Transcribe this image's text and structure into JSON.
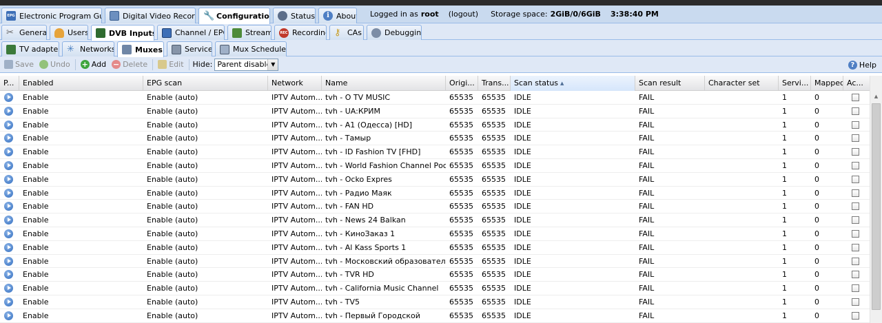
{
  "main_tabs": [
    {
      "label": "Electronic Program Guide",
      "icon": "epg-icon",
      "icon_text": "EPG",
      "active": false
    },
    {
      "label": "Digital Video Recorder",
      "icon": "dvr-icon",
      "active": false
    },
    {
      "label": "Configuration",
      "icon": "wrench-icon",
      "active": true
    },
    {
      "label": "Status",
      "icon": "eye-icon",
      "active": false
    },
    {
      "label": "About",
      "icon": "info-icon",
      "icon_text": "i",
      "active": false
    }
  ],
  "session": {
    "logged_in_prefix": "Logged in as",
    "user": "root",
    "logout": "(logout)",
    "storage_label": "Storage space:",
    "storage_value": "2GiB/0/6GiB",
    "time": "3:38:40 PM"
  },
  "config_tabs": [
    {
      "label": "General",
      "icon": "tools-icon",
      "active": false
    },
    {
      "label": "Users",
      "icon": "users-icon",
      "active": false
    },
    {
      "label": "DVB Inputs",
      "icon": "dvb-icon",
      "active": true
    },
    {
      "label": "Channel / EPG",
      "icon": "tv-icon",
      "active": false
    },
    {
      "label": "Stream",
      "icon": "stream-icon",
      "active": false
    },
    {
      "label": "Recording",
      "icon": "rec-icon",
      "icon_text": "REC",
      "active": false
    },
    {
      "label": "CAs",
      "icon": "key-icon",
      "active": false
    },
    {
      "label": "Debugging",
      "icon": "debug-icon",
      "active": false
    }
  ],
  "dvb_tabs": [
    {
      "label": "TV adapters",
      "icon": "adapter-icon",
      "active": false
    },
    {
      "label": "Networks",
      "icon": "network-icon",
      "active": false
    },
    {
      "label": "Muxes",
      "icon": "mux-icon",
      "active": true
    },
    {
      "label": "Services",
      "icon": "services-icon",
      "active": false
    },
    {
      "label": "Mux Schedulers",
      "icon": "scheduler-icon",
      "active": false
    }
  ],
  "toolbar": {
    "save": "Save",
    "undo": "Undo",
    "add": "Add",
    "add_symbol": "+",
    "delete": "Delete",
    "delete_symbol": "−",
    "edit": "Edit",
    "hide_label": "Hide:",
    "hide_value": "Parent disabled",
    "help": "Help",
    "help_symbol": "?"
  },
  "columns": [
    {
      "label": "P..."
    },
    {
      "label": "Enabled"
    },
    {
      "label": "EPG scan"
    },
    {
      "label": "Network"
    },
    {
      "label": "Name"
    },
    {
      "label": "Origi..."
    },
    {
      "label": "Trans..."
    },
    {
      "label": "Scan status",
      "sorted": "asc"
    },
    {
      "label": "Scan result"
    },
    {
      "label": "Character set"
    },
    {
      "label": "Servi..."
    },
    {
      "label": "Mapped"
    },
    {
      "label": "Ac..."
    }
  ],
  "rows": [
    {
      "enabled": "Enable",
      "epg": "Enable (auto)",
      "network": "IPTV Autom...",
      "name": "tvh - O TV MUSIC",
      "orig": "65535",
      "trans": "65535",
      "status": "IDLE",
      "result": "FAIL",
      "charset": "",
      "services": "1",
      "mapped": "0"
    },
    {
      "enabled": "Enable",
      "epg": "Enable (auto)",
      "network": "IPTV Autom...",
      "name": "tvh - UA:КРИМ",
      "orig": "65535",
      "trans": "65535",
      "status": "IDLE",
      "result": "FAIL",
      "charset": "",
      "services": "1",
      "mapped": "0"
    },
    {
      "enabled": "Enable",
      "epg": "Enable (auto)",
      "network": "IPTV Autom...",
      "name": "tvh - A1 (Одесса) [HD]",
      "orig": "65535",
      "trans": "65535",
      "status": "IDLE",
      "result": "FAIL",
      "charset": "",
      "services": "1",
      "mapped": "0"
    },
    {
      "enabled": "Enable",
      "epg": "Enable (auto)",
      "network": "IPTV Autom...",
      "name": "tvh - Тамыр",
      "orig": "65535",
      "trans": "65535",
      "status": "IDLE",
      "result": "FAIL",
      "charset": "",
      "services": "1",
      "mapped": "0"
    },
    {
      "enabled": "Enable",
      "epg": "Enable (auto)",
      "network": "IPTV Autom...",
      "name": "tvh - ID Fashion TV [FHD]",
      "orig": "65535",
      "trans": "65535",
      "status": "IDLE",
      "result": "FAIL",
      "charset": "",
      "services": "1",
      "mapped": "0"
    },
    {
      "enabled": "Enable",
      "epg": "Enable (auto)",
      "network": "IPTV Autom...",
      "name": "tvh - World Fashion Channel Росс...",
      "orig": "65535",
      "trans": "65535",
      "status": "IDLE",
      "result": "FAIL",
      "charset": "",
      "services": "1",
      "mapped": "0"
    },
    {
      "enabled": "Enable",
      "epg": "Enable (auto)",
      "network": "IPTV Autom...",
      "name": "tvh - Ocko Expres",
      "orig": "65535",
      "trans": "65535",
      "status": "IDLE",
      "result": "FAIL",
      "charset": "",
      "services": "1",
      "mapped": "0"
    },
    {
      "enabled": "Enable",
      "epg": "Enable (auto)",
      "network": "IPTV Autom...",
      "name": "tvh - Радио Маяк",
      "orig": "65535",
      "trans": "65535",
      "status": "IDLE",
      "result": "FAIL",
      "charset": "",
      "services": "1",
      "mapped": "0"
    },
    {
      "enabled": "Enable",
      "epg": "Enable (auto)",
      "network": "IPTV Autom...",
      "name": "tvh - FAN HD",
      "orig": "65535",
      "trans": "65535",
      "status": "IDLE",
      "result": "FAIL",
      "charset": "",
      "services": "1",
      "mapped": "0"
    },
    {
      "enabled": "Enable",
      "epg": "Enable (auto)",
      "network": "IPTV Autom...",
      "name": "tvh - News 24 Balkan",
      "orig": "65535",
      "trans": "65535",
      "status": "IDLE",
      "result": "FAIL",
      "charset": "",
      "services": "1",
      "mapped": "0"
    },
    {
      "enabled": "Enable",
      "epg": "Enable (auto)",
      "network": "IPTV Autom...",
      "name": "tvh - КиноЗаказ 1",
      "orig": "65535",
      "trans": "65535",
      "status": "IDLE",
      "result": "FAIL",
      "charset": "",
      "services": "1",
      "mapped": "0"
    },
    {
      "enabled": "Enable",
      "epg": "Enable (auto)",
      "network": "IPTV Autom...",
      "name": "tvh - Al Kass Sports 1",
      "orig": "65535",
      "trans": "65535",
      "status": "IDLE",
      "result": "FAIL",
      "charset": "",
      "services": "1",
      "mapped": "0"
    },
    {
      "enabled": "Enable",
      "epg": "Enable (auto)",
      "network": "IPTV Autom...",
      "name": "tvh - Московский образовательн...",
      "orig": "65535",
      "trans": "65535",
      "status": "IDLE",
      "result": "FAIL",
      "charset": "",
      "services": "1",
      "mapped": "0"
    },
    {
      "enabled": "Enable",
      "epg": "Enable (auto)",
      "network": "IPTV Autom...",
      "name": "tvh - TVR HD",
      "orig": "65535",
      "trans": "65535",
      "status": "IDLE",
      "result": "FAIL",
      "charset": "",
      "services": "1",
      "mapped": "0"
    },
    {
      "enabled": "Enable",
      "epg": "Enable (auto)",
      "network": "IPTV Autom...",
      "name": "tvh - California Music Channel",
      "orig": "65535",
      "trans": "65535",
      "status": "IDLE",
      "result": "FAIL",
      "charset": "",
      "services": "1",
      "mapped": "0"
    },
    {
      "enabled": "Enable",
      "epg": "Enable (auto)",
      "network": "IPTV Autom...",
      "name": "tvh - TV5",
      "orig": "65535",
      "trans": "65535",
      "status": "IDLE",
      "result": "FAIL",
      "charset": "",
      "services": "1",
      "mapped": "0"
    },
    {
      "enabled": "Enable",
      "epg": "Enable (auto)",
      "network": "IPTV Autom...",
      "name": "tvh - Первый Городской",
      "orig": "65535",
      "trans": "65535",
      "status": "IDLE",
      "result": "FAIL",
      "charset": "",
      "services": "1",
      "mapped": "0"
    }
  ]
}
